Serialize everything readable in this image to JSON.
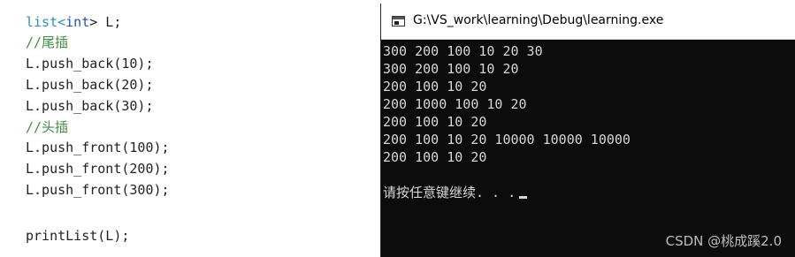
{
  "editor": {
    "lines": {
      "l1": {
        "type": "list",
        "lt": "<",
        "int": "int",
        "rest": "> L;"
      },
      "l2": {
        "text": "//尾插"
      },
      "l3": {
        "text": "L.push_back(10);"
      },
      "l4": {
        "text": "L.push_back(20);"
      },
      "l5": {
        "text": "L.push_back(30);"
      },
      "l6": {
        "text": "//头插"
      },
      "l7": {
        "text": "L.push_front(100);"
      },
      "l8": {
        "text": "L.push_front(200);"
      },
      "l9": {
        "text": "L.push_front(300);"
      },
      "l10": {
        "text": "printList(L);"
      }
    }
  },
  "console": {
    "title": "G:\\VS_work\\learning\\Debug\\learning.exe",
    "icon": "console-window-icon",
    "output": [
      "300 200 100 10 20 30",
      "300 200 100 10 20",
      "200 100 10 20",
      "200 1000 100 10 20",
      "200 100 10 20",
      "200 100 10 20 10000 10000 10000",
      "200 100 10 20"
    ],
    "prompt": "请按任意键继续. . ."
  },
  "watermark": "CSDN @桃成蹊2.0",
  "colors": {
    "console_bg": "#0c0c0c",
    "console_text": "#d6d6d6",
    "comment": "#3e8e3e",
    "type_keyword": "#2b91af"
  }
}
